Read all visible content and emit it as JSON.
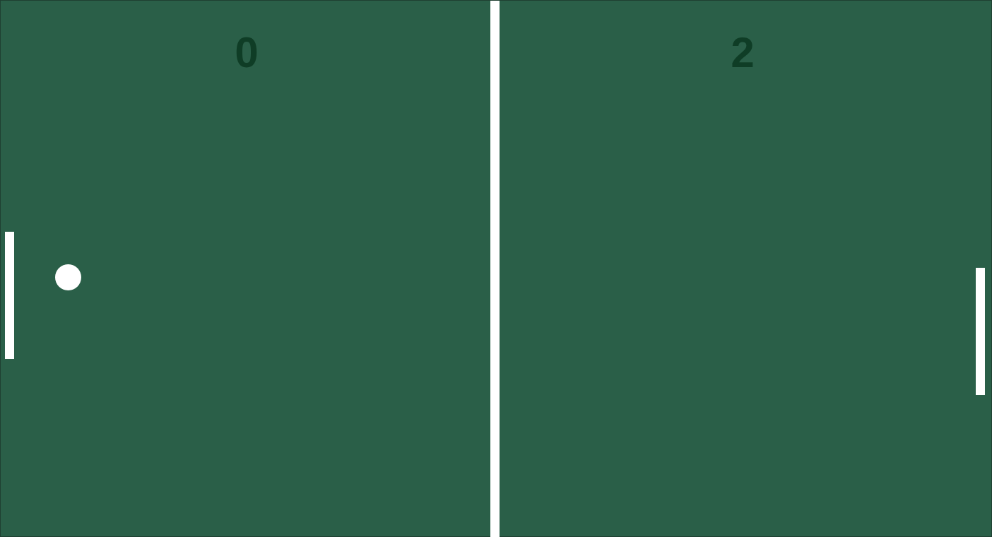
{
  "game": {
    "type": "pong",
    "score": {
      "left": "0",
      "right": "2"
    },
    "colors": {
      "court": "#2a5f48",
      "score_text": "#0f3d26",
      "paddles_ball_net": "#ffffff"
    }
  }
}
